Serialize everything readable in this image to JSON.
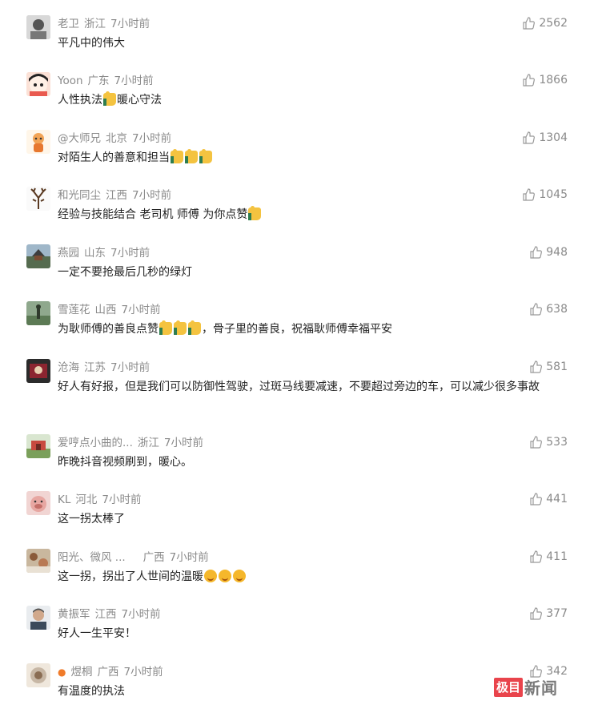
{
  "comments": [
    {
      "user": "老卫",
      "region": "浙江",
      "time": "7小时前",
      "likes": "2562",
      "text": "平凡中的伟大",
      "avatar_color": "#b9b9b9"
    },
    {
      "user": "Yoon",
      "region": "广东",
      "time": "7小时前",
      "likes": "1866",
      "text_a": "人性执法",
      "text_b": "暖心守法",
      "avatar_color": "#e95a4f"
    },
    {
      "user": "@大师兄",
      "region": "北京",
      "time": "7小时前",
      "likes": "1304",
      "text": "对陌生人的善意和担当",
      "avatar_color": "#f2a456"
    },
    {
      "user": "和光同尘",
      "region": "江西",
      "time": "7小时前",
      "likes": "1045",
      "text": "经验与技能结合 老司机 师傅 为你点赞",
      "avatar_color": "#efefef"
    },
    {
      "user": "燕园",
      "region": "山东",
      "time": "7小时前",
      "likes": "948",
      "text": "一定不要抢最后几秒的绿灯",
      "avatar_color": "#6f8a6a"
    },
    {
      "user": "雪莲花",
      "region": "山西",
      "time": "7小时前",
      "likes": "638",
      "text_a": "为耿师傅的善良点赞",
      "text_b": "，骨子里的善良，祝福耿师傅幸福平安",
      "avatar_color": "#7d9a7c"
    },
    {
      "user": "沧海",
      "region": "江苏",
      "time": "7小时前",
      "likes": "581",
      "text": "好人有好报，但是我们可以防御性驾驶，过斑马线要减速，不要超过旁边的车，可以减少很多事故",
      "avatar_color": "#8c2530"
    },
    {
      "user": "爱哼点小曲的...",
      "region": "浙江",
      "time": "7小时前",
      "likes": "533",
      "text": "昨晚抖音视频刷到，暖心。",
      "avatar_color": "#c84a3f"
    },
    {
      "user": "KL",
      "region": "河北",
      "time": "7小时前",
      "likes": "441",
      "text": "这一拐太棒了",
      "avatar_color": "#d9918c"
    },
    {
      "user": "阳光、微风 ...",
      "region": "广西",
      "time": "7小时前",
      "likes": "411",
      "text": "这一拐，拐出了人世间的温暖",
      "avatar_color": "#a98a6b"
    },
    {
      "user": "黄振军",
      "region": "江西",
      "time": "7小时前",
      "likes": "377",
      "text": "好人一生平安！",
      "avatar_color": "#8e8e90"
    },
    {
      "user": "煜桐",
      "region": "广西",
      "time": "7小时前",
      "likes": "342",
      "text": "有温度的执法",
      "avatar_color": "#c7b7a5"
    }
  ],
  "watermark": {
    "box": "极目",
    "text": "新闻"
  }
}
